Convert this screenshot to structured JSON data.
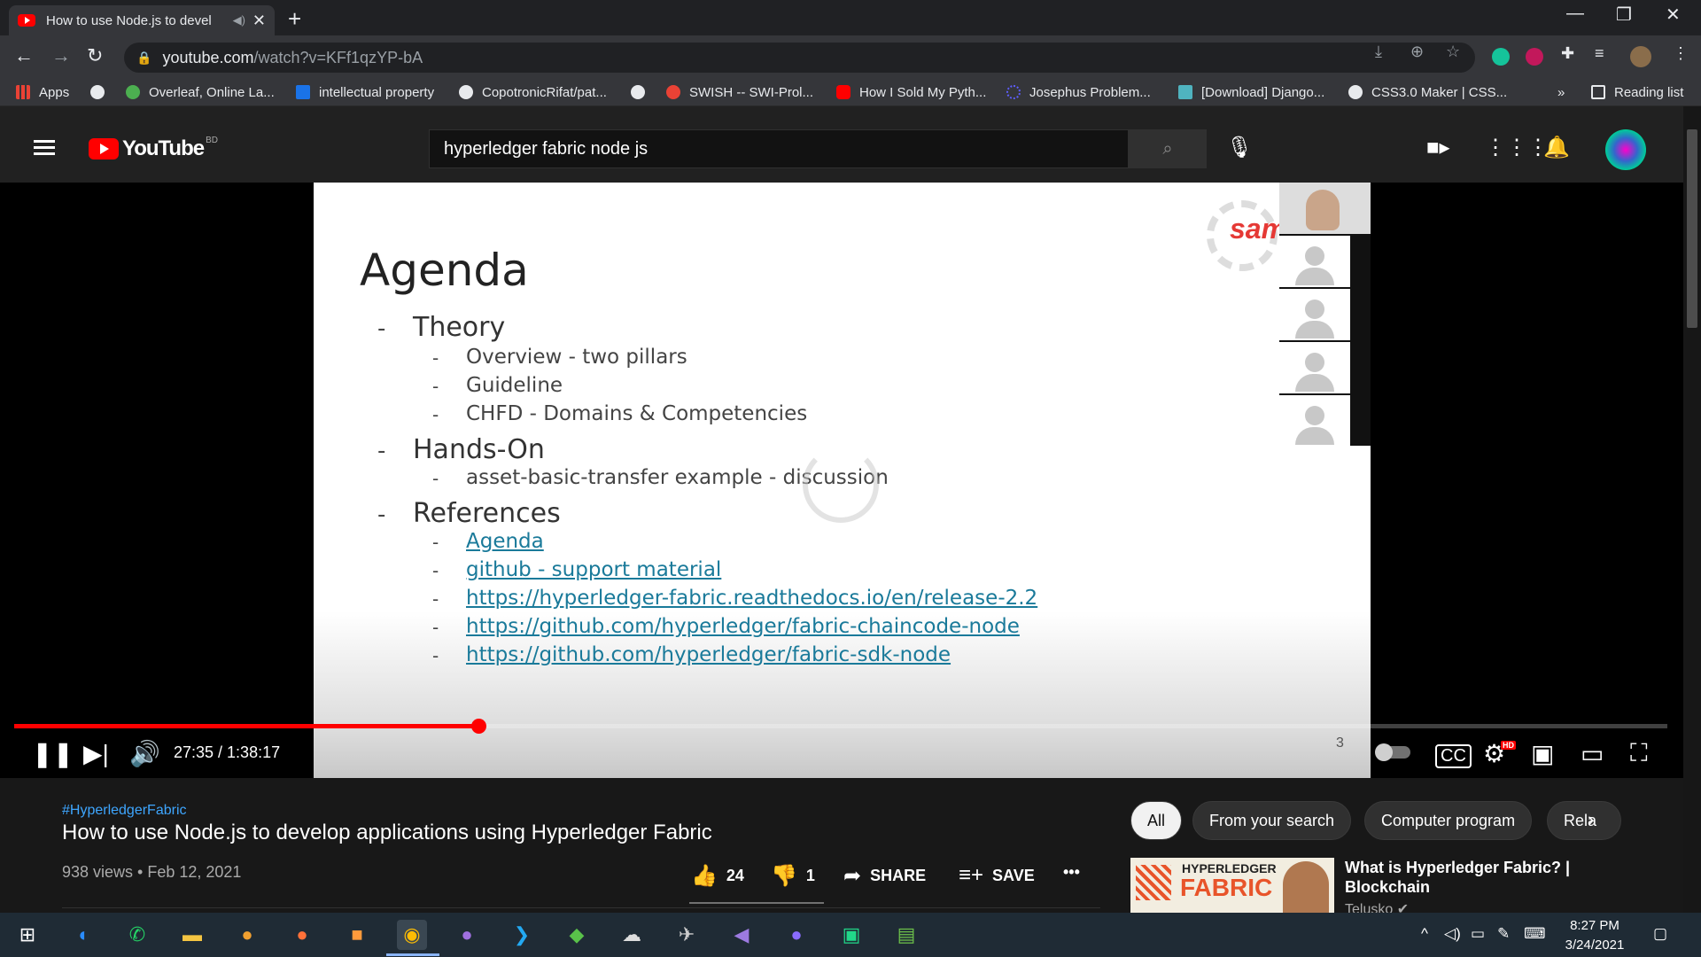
{
  "browser": {
    "tab_title": "How to use Node.js to devel",
    "omnibox_host": "youtube.com",
    "omnibox_path": "/watch?v=KFf1qzYP-bA",
    "bookmarks": [
      {
        "label": "Apps",
        "color": "#e94235"
      },
      {
        "label": "",
        "color": "#9aa0a6"
      },
      {
        "label": "Overleaf, Online La...",
        "color": "#4caf50"
      },
      {
        "label": "intellectual property",
        "color": "#1a73e8"
      },
      {
        "label": "CopotronicRifat/pat...",
        "color": "#e8eaed"
      },
      {
        "label": "",
        "color": "#9aa0a6"
      },
      {
        "label": "SWISH -- SWI-Prol...",
        "color": "#e94235"
      },
      {
        "label": "How I Sold My Pyth...",
        "color": "#ff0000"
      },
      {
        "label": "Josephus Problem...",
        "color": "#5e5eff"
      },
      {
        "label": "[Download] Django...",
        "color": "#4fb3bf"
      },
      {
        "label": "CSS3.0 Maker | CSS...",
        "color": "#9aa0a6"
      }
    ],
    "bookmarks_overflow": "»",
    "reading_list": "Reading list"
  },
  "youtube": {
    "logo_word": "YouTube",
    "country_code": "BD",
    "search_query": "hyperledger fabric node js"
  },
  "slide": {
    "title": "Agenda",
    "items": [
      {
        "level": 1,
        "text": "Theory"
      },
      {
        "level": 2,
        "text": "Overview - two pillars"
      },
      {
        "level": 2,
        "text": "Guideline"
      },
      {
        "level": 2,
        "text": "CHFD - Domains & Competencies"
      },
      {
        "level": 1,
        "text": "Hands-On"
      },
      {
        "level": 2,
        "text": "asset-basic-transfer example - discussion"
      },
      {
        "level": 1,
        "text": "References"
      },
      {
        "level": 2,
        "text": "Agenda",
        "link": true
      },
      {
        "level": 2,
        "text": "github - support material",
        "link": true
      },
      {
        "level": 2,
        "text": "https://hyperledger-fabric.readthedocs.io/en/release-2.2",
        "link": true
      },
      {
        "level": 2,
        "text": "https://github.com/hyperledger/fabric-chaincode-node",
        "link": true
      },
      {
        "level": 2,
        "text": "https://github.com/hyperledger/fabric-sdk-node",
        "link": true
      }
    ],
    "logo_text": "sam",
    "page_number": "3"
  },
  "player": {
    "current_time": "27:35",
    "duration": "1:38:17",
    "time_display": "27:35 / 1:38:17",
    "progress_fraction": 0.2806,
    "hd_badge": "HD"
  },
  "video": {
    "hashtag": "#HyperledgerFabric",
    "title": "How to use Node.js to develop applications using Hyperledger Fabric",
    "meta": "938 views • Feb 12, 2021",
    "likes": "24",
    "dislikes": "1",
    "share_label": "SHARE",
    "save_label": "SAVE",
    "more": "•••"
  },
  "chips": [
    "All",
    "From your search",
    "Computer program",
    "Rela"
  ],
  "related": {
    "thumb_line1": "HYPERLEDGER",
    "thumb_line2": "FABRIC",
    "title": "What is Hyperledger Fabric? | Blockchain",
    "channel": "Telusko ✔"
  },
  "taskbar": {
    "time": "8:27 PM",
    "date": "3/24/2021"
  }
}
